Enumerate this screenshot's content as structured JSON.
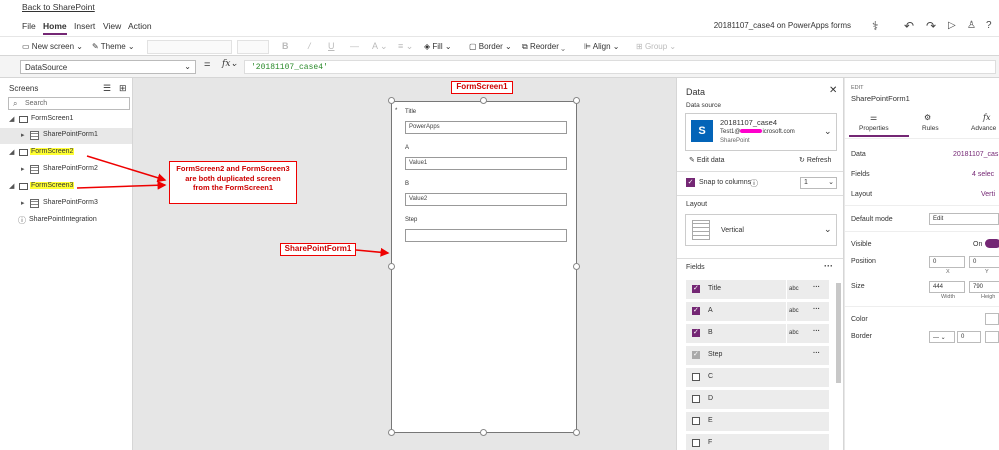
{
  "topbar": {
    "back_link": "Back to SharePoint"
  },
  "menu": {
    "items": [
      "File",
      "Home",
      "Insert",
      "View",
      "Action"
    ],
    "app_title": "20181107_case4 on PowerApps forms"
  },
  "toolbar": {
    "new_screen": "New screen",
    "theme": "Theme",
    "fill": "Fill",
    "border": "Border",
    "reorder": "Reorder",
    "align": "Align",
    "group": "Group"
  },
  "formula": {
    "property": "DataSource",
    "eq": "=",
    "fx": "fx",
    "value": "'20181107_case4'"
  },
  "screens_panel": {
    "title": "Screens",
    "search_placeholder": "Search",
    "tree": [
      {
        "label": "FormScreen1",
        "level": 0
      },
      {
        "label": "SharePointForm1",
        "level": 1
      },
      {
        "label": "FormScreen2",
        "level": 0
      },
      {
        "label": "SharePointForm2",
        "level": 1
      },
      {
        "label": "FormScreen3",
        "level": 0
      },
      {
        "label": "SharePointForm3",
        "level": 1
      },
      {
        "label": "SharePointIntegration",
        "level": 0
      }
    ]
  },
  "form": {
    "fields": [
      {
        "label": "Title",
        "value": "PowerApps"
      },
      {
        "label": "A",
        "value": "Value1"
      },
      {
        "label": "B",
        "value": "Value2"
      },
      {
        "label": "Step",
        "value": ""
      }
    ]
  },
  "annotations": {
    "screen_label": "FormScreen1",
    "form_label": "SharePointForm1",
    "note": "FormScreen2 and FormScreen3 are both duplicated screen from the FormScreen1",
    "color": "#e00000"
  },
  "data_panel": {
    "title": "Data",
    "data_source_label": "Data source",
    "source_name": "20181107_case4",
    "source_user": "Test1@",
    "source_domain": "icrosoft.com",
    "source_type": "SharePoint",
    "edit_data": "Edit data",
    "refresh": "Refresh",
    "snap_label": "Snap to columns",
    "columns_value": "1",
    "layout_label": "Layout",
    "layout_value": "Vertical",
    "fields_label": "Fields",
    "fields": [
      {
        "name": "Title",
        "type": "abc",
        "checked": true,
        "state": "on"
      },
      {
        "name": "A",
        "type": "abc",
        "checked": true,
        "state": "on"
      },
      {
        "name": "B",
        "type": "abc",
        "checked": true,
        "state": "on"
      },
      {
        "name": "Step",
        "type": "",
        "checked": true,
        "state": "grey"
      },
      {
        "name": "C",
        "type": "",
        "checked": false,
        "state": "off"
      },
      {
        "name": "D",
        "type": "",
        "checked": false,
        "state": "off"
      },
      {
        "name": "E",
        "type": "",
        "checked": false,
        "state": "off"
      },
      {
        "name": "F",
        "type": "",
        "checked": false,
        "state": "off"
      }
    ]
  },
  "props_panel": {
    "edit_label": "EDIT",
    "control_name": "SharePointForm1",
    "tabs": [
      "Properties",
      "Rules",
      "Advance"
    ],
    "rows": {
      "data": {
        "label": "Data",
        "value": "20181107_cas"
      },
      "fields": {
        "label": "Fields",
        "value": "4 selec"
      },
      "layout": {
        "label": "Layout",
        "value": "Verti"
      },
      "default_mode": {
        "label": "Default mode",
        "value": "Edit"
      },
      "visible": {
        "label": "Visible",
        "value": "On"
      },
      "position": {
        "label": "Position",
        "x": "0",
        "y": "0",
        "x_sub": "X",
        "y_sub": "Y"
      },
      "size": {
        "label": "Size",
        "w": "444",
        "h": "790",
        "w_sub": "Width",
        "h_sub": "Heigh"
      },
      "color": {
        "label": "Color"
      },
      "border": {
        "label": "Border",
        "value": "0"
      }
    }
  },
  "colors": {
    "accent": "#742774",
    "sharepoint": "#0364b8",
    "highlight": "#ffff33"
  }
}
